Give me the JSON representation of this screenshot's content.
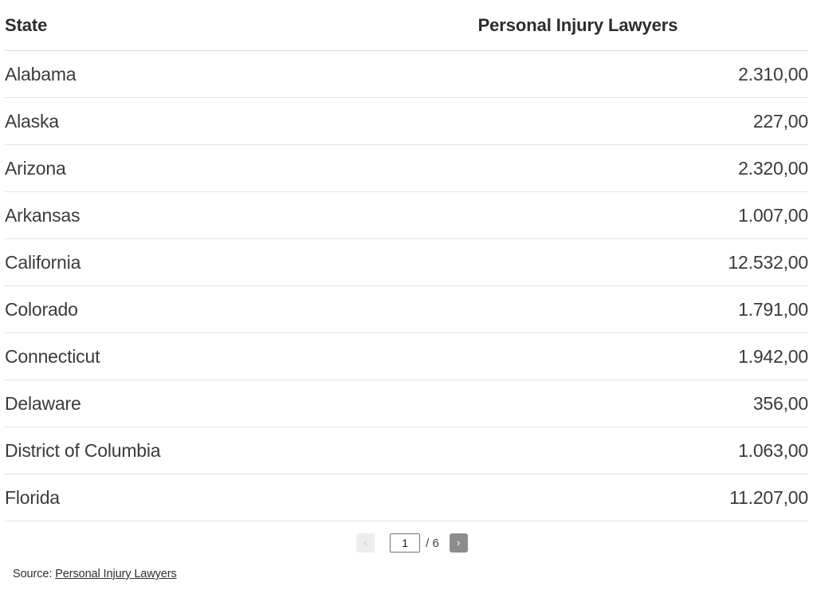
{
  "table": {
    "columns": [
      {
        "key": "state",
        "label": "State",
        "align": "left"
      },
      {
        "key": "value",
        "label": "Personal Injury Lawyers",
        "align": "center"
      }
    ],
    "rows": [
      {
        "state": "Alabama",
        "value": "2.310,00"
      },
      {
        "state": "Alaska",
        "value": "227,00"
      },
      {
        "state": "Arizona",
        "value": "2.320,00"
      },
      {
        "state": "Arkansas",
        "value": "1.007,00"
      },
      {
        "state": "California",
        "value": "12.532,00"
      },
      {
        "state": "Colorado",
        "value": "1.791,00"
      },
      {
        "state": "Connecticut",
        "value": "1.942,00"
      },
      {
        "state": "Delaware",
        "value": "356,00"
      },
      {
        "state": "District of Columbia",
        "value": "1.063,00"
      },
      {
        "state": "Florida",
        "value": "11.207,00"
      }
    ]
  },
  "pagination": {
    "prev_label": "‹",
    "prev_icon": "chevron-left-icon",
    "next_label": "›",
    "next_icon": "chevron-right-icon",
    "current_page": "1",
    "total_pages_label": "/ 6",
    "total_pages": "6"
  },
  "footer": {
    "source_label": "Source: ",
    "source_link_text": "Personal Injury Lawyers"
  },
  "colors": {
    "header_text": "#2c2c2c",
    "body_text": "#3b3b3b",
    "row_border": "#e4e4e4",
    "header_border": "#dcdcdc",
    "pager_active_bg": "#8d8d8d",
    "pager_disabled_bg": "#ededed",
    "background": "#ffffff"
  }
}
